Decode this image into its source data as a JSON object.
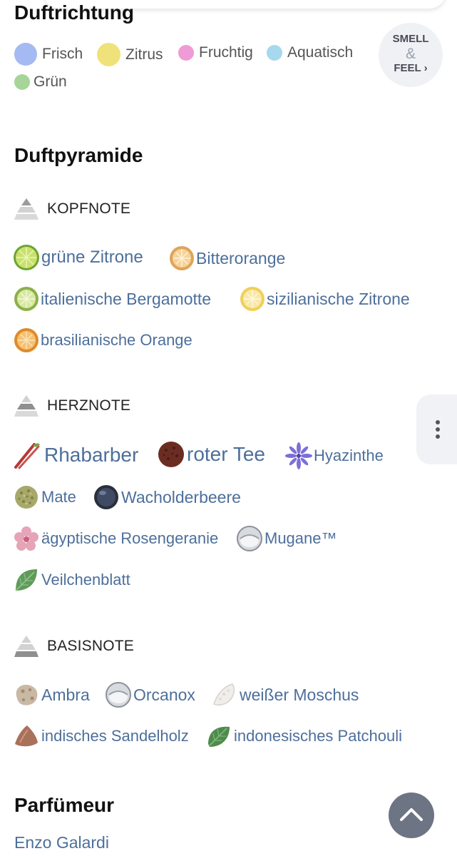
{
  "direction": {
    "title": "Duftrichtung",
    "legend": [
      {
        "label": "Frisch",
        "color": "#a5b9f2"
      },
      {
        "label": "Zitrus",
        "color": "#f0e27a"
      },
      {
        "label": "Fruchtig",
        "color": "#ee9bd6"
      },
      {
        "label": "Aquatisch",
        "color": "#a6d8ee"
      },
      {
        "label": "Grün",
        "color": "#a7d599"
      }
    ],
    "smell_button": {
      "line1": "SMELL",
      "amp": "&",
      "line2": "FEEL ›"
    }
  },
  "pyramid": {
    "title": "Duftpyramide",
    "top": {
      "label": "KOPFNOTE",
      "items": [
        {
          "label": "grüne Zitrone",
          "icon": "lime-icon"
        },
        {
          "label": "Bitterorange",
          "icon": "bitter-orange-icon"
        },
        {
          "label": "italienische Bergamotte",
          "icon": "bergamot-icon"
        },
        {
          "label": "sizilianische Zitrone",
          "icon": "lemon-icon"
        },
        {
          "label": "brasilianische Orange",
          "icon": "orange-icon"
        }
      ]
    },
    "heart": {
      "label": "HERZNOTE",
      "items": [
        {
          "label": "Rhabarber",
          "icon": "rhubarb-icon"
        },
        {
          "label": "roter Tee",
          "icon": "red-tea-icon"
        },
        {
          "label": "Hyazinthe",
          "icon": "hyacinth-icon"
        },
        {
          "label": "Mate",
          "icon": "mate-icon"
        },
        {
          "label": "Wacholderbeere",
          "icon": "juniper-berry-icon"
        },
        {
          "label": "ägyptische Rosengeranie",
          "icon": "rose-geranium-icon"
        },
        {
          "label": "Mugane™",
          "icon": "molecule-drop-icon"
        },
        {
          "label": "Veilchenblatt",
          "icon": "violet-leaf-icon"
        }
      ]
    },
    "base": {
      "label": "BASISNOTE",
      "items": [
        {
          "label": "Ambra",
          "icon": "amber-stone-icon"
        },
        {
          "label": "Orcanox",
          "icon": "molecule-drop-icon"
        },
        {
          "label": "weißer Moschus",
          "icon": "white-musk-icon"
        },
        {
          "label": "indisches Sandelholz",
          "icon": "sandalwood-icon"
        },
        {
          "label": "indonesisches Patchouli",
          "icon": "patchouli-leaf-icon"
        }
      ]
    }
  },
  "perfumer": {
    "title": "Parfümeur",
    "name": "Enzo Galardi"
  }
}
